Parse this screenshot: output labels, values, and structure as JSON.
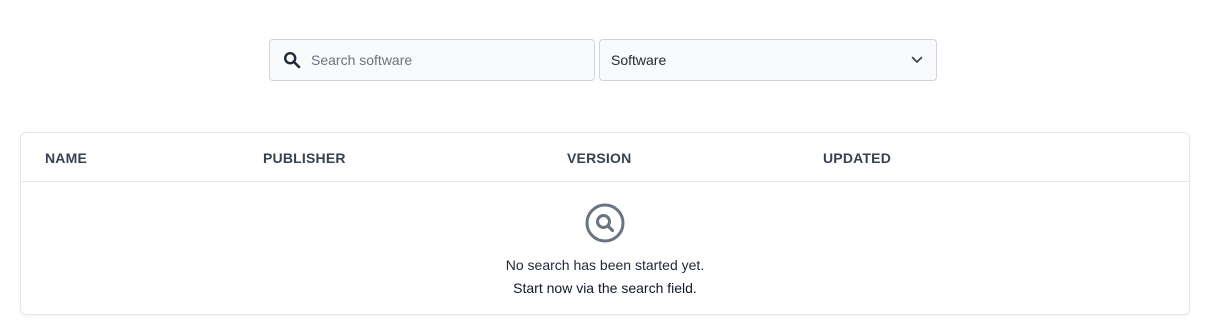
{
  "search": {
    "placeholder": "Search software",
    "value": "",
    "icon": "search-icon"
  },
  "filter": {
    "selected": "Software",
    "icon": "chevron-down-icon"
  },
  "table": {
    "columns": [
      "NAME",
      "PUBLISHER",
      "VERSION",
      "UPDATED"
    ],
    "rows": []
  },
  "empty_state": {
    "icon": "search-circle-icon",
    "message": "No search has been started yet.",
    "hint": "Start now via the search field."
  },
  "colors": {
    "border": "#d1d5db",
    "field_bg": "#f9fafb",
    "icon_gray": "#6b7280",
    "text": "#1f2937"
  }
}
